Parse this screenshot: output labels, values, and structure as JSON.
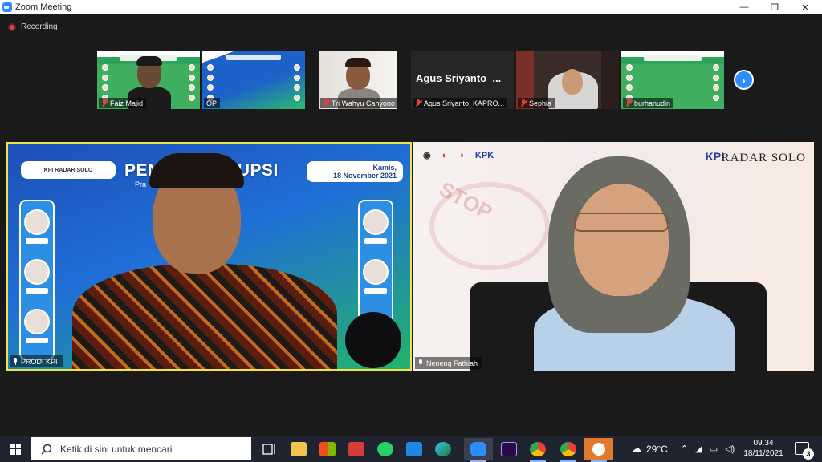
{
  "window": {
    "title": "Zoom Meeting",
    "minimize": "—",
    "restore": "❐",
    "close": "✕"
  },
  "recording": {
    "label": "Recording",
    "color": "#e0433b"
  },
  "thumbnails": [
    {
      "name": "Faiz Majid",
      "mic": "muted"
    },
    {
      "name": "OP",
      "mic": "on"
    },
    {
      "name": "Tri Wahyu Cahyono",
      "mic": "muted"
    },
    {
      "name": "Agus Sriyanto_KAPRO...",
      "display_name": "Agus  Sriyanto_...",
      "mic": "muted"
    },
    {
      "name": "Sephia",
      "mic": "muted"
    },
    {
      "name": "burhanudin",
      "mic": "muted"
    }
  ],
  "next_page_icon": "chevron-right-icon",
  "main_videos": {
    "left": {
      "name": "PRODI KPI",
      "active_speaker_color": "#f0e44a",
      "banner_title": "PEN         NTI KORUPSI",
      "banner_sub": "Pra         ktisi Media",
      "date_line1": "Kamis,",
      "date_line2": "18 November 2021",
      "logo_text": "KPI  RADAR SOLO"
    },
    "right": {
      "name": "Neneng Fathiah",
      "logos": [
        "KPK"
      ],
      "kpi_text": "KPI",
      "radar_text": "RADAR SOLO",
      "stamp_text": "STOP"
    }
  },
  "taskbar": {
    "search_placeholder": "Ketik di sini untuk mencari",
    "weather": "29°C",
    "time": "09.34",
    "date": "18/11/2021",
    "notifications": "3",
    "accent": "#1f2430"
  }
}
